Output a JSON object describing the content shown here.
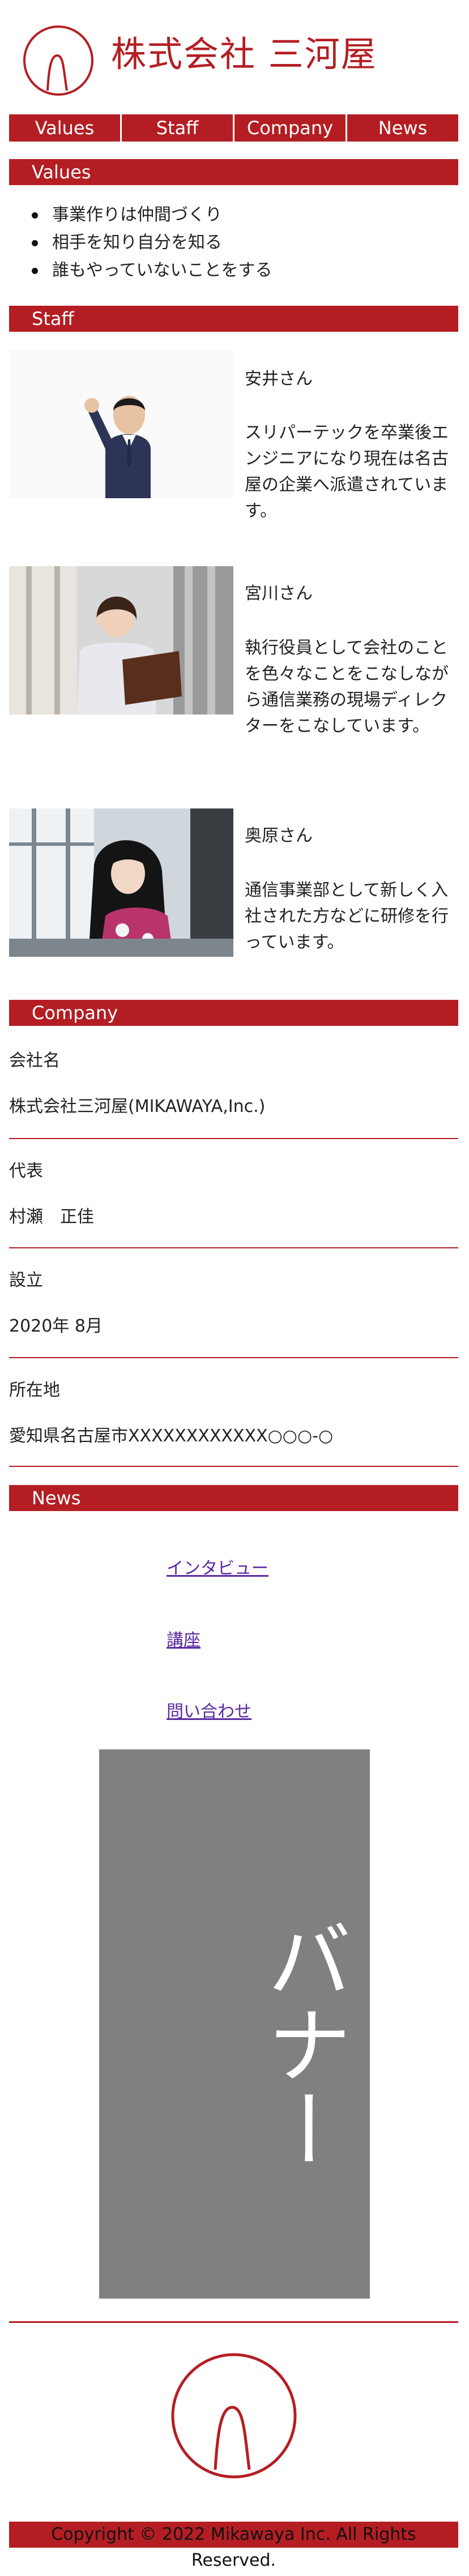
{
  "header": {
    "title": "株式会社 三河屋"
  },
  "nav": [
    {
      "label": "Values"
    },
    {
      "label": "Staff"
    },
    {
      "label": "Company"
    },
    {
      "label": "News"
    }
  ],
  "values": {
    "heading": "Values",
    "items": [
      "事業作りは仲間づくり",
      "相手を知り自分を知る",
      "誰もやっていないことをする"
    ]
  },
  "staff": {
    "heading": "Staff",
    "members": [
      {
        "name": "安井さん",
        "desc": "スリパーテックを卒業後エンジニアになり現在は名古屋の企業へ派遣されています。"
      },
      {
        "name": "宮川さん",
        "desc": "執行役員として会社のことを色々なことをこなしながら通信業務の現場ディレクターをこなしています。"
      },
      {
        "name": "奥原さん",
        "desc": "通信事業部として新しく入社された方などに研修を行っています。"
      }
    ]
  },
  "company": {
    "heading": "Company",
    "rows": [
      {
        "label": "会社名",
        "value": "株式会社三河屋(MIKAWAYA,Inc.)"
      },
      {
        "label": "代表",
        "value": "村瀬　正佳"
      },
      {
        "label": "設立",
        "value": "2020年 8月"
      },
      {
        "label": "所在地",
        "value": "愛知県名古屋市XXXXXXXXXXXX○○○-○"
      }
    ]
  },
  "news": {
    "heading": "News",
    "links": [
      "インタビュー",
      "講座",
      "問い合わせ"
    ],
    "banner_text": "バナー"
  },
  "footer": {
    "copyright": "Copyright © 2022 Mikawaya Inc. All Rights Reserved."
  },
  "colors": {
    "accent": "#b41e23",
    "banner": "#808080"
  }
}
